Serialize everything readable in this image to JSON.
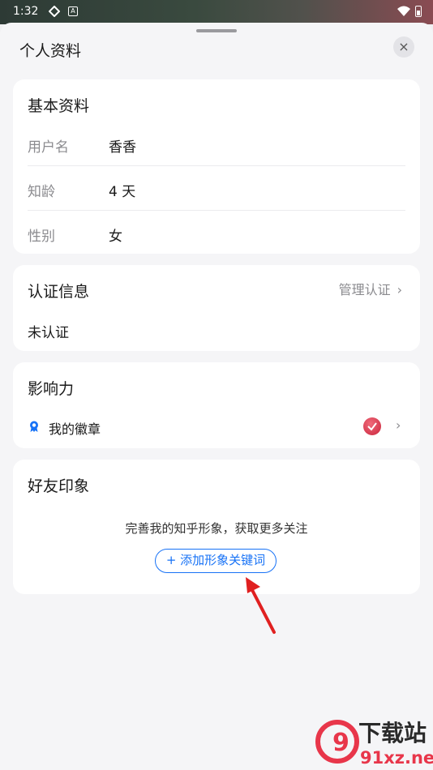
{
  "status_bar": {
    "time": "1:32"
  },
  "sheet": {
    "title": "个人资料",
    "close_icon": "×"
  },
  "basic_info": {
    "title": "基本资料",
    "rows": [
      {
        "label": "用户名",
        "value": "香香"
      },
      {
        "label": "知龄",
        "value": "4 天"
      },
      {
        "label": "性别",
        "value": "女"
      }
    ]
  },
  "certification": {
    "title": "认证信息",
    "manage_label": "管理认证",
    "status": "未认证"
  },
  "influence": {
    "title": "影响力",
    "badge_label": "我的徽章"
  },
  "friend_impression": {
    "title": "好友印象",
    "prompt": "完善我的知乎形象，获取更多关注",
    "add_keyword_label": "+ 添加形象关键词"
  },
  "watermark": {
    "text1": "下载站",
    "text2": "91xz.net"
  },
  "colors": {
    "accent": "#1772f6",
    "annotation_arrow": "#e02020",
    "medal": "#d6334a"
  }
}
